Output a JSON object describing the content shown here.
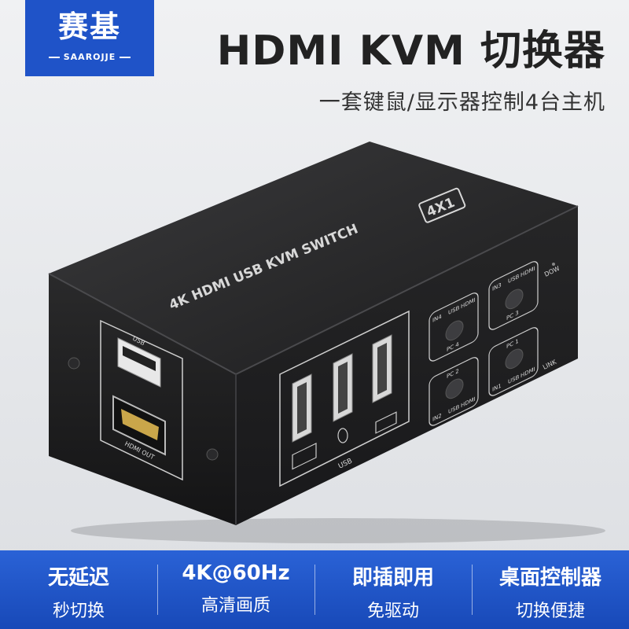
{
  "brand": {
    "name_cn": "赛基",
    "name_en": "SAAROJJE"
  },
  "header": {
    "title": "HDMI KVM 切换器",
    "subtitle": "一套键鼠/显示器控制4台主机"
  },
  "device": {
    "top_label": "4K HDMI USB KVM SWITCH",
    "badge": "4X1",
    "left_panel": {
      "usb_label": "USB",
      "hdmi_label": "HDMI OUT"
    },
    "usb_panel_label": "USB",
    "pc_buttons": [
      {
        "pc": "PC 4",
        "in": "IN4",
        "usb": "USB",
        "hdmi": "HDMI"
      },
      {
        "pc": "PC 3",
        "in": "IN3",
        "usb": "USB",
        "hdmi": "HDMI"
      },
      {
        "pc": "PC 2",
        "in": "IN2",
        "usb": "USB",
        "hdmi": "HDMI"
      },
      {
        "pc": "PC 1",
        "in": "IN1",
        "usb": "USB",
        "hdmi": "HDMI"
      }
    ],
    "indicator_dow": "DOW",
    "indicator_link": "LINK",
    "colors": {
      "body": "#1e1e1f",
      "edge": "#3a3a3c",
      "print": "#d8d8d8"
    }
  },
  "features": [
    {
      "title": "无延迟",
      "sub": "秒切换"
    },
    {
      "title": "4K@60Hz",
      "sub": "高清画质"
    },
    {
      "title": "即插即用",
      "sub": "免驱动"
    },
    {
      "title": "桌面控制器",
      "sub": "切换便捷"
    }
  ],
  "accent_color": "#1f53c8"
}
